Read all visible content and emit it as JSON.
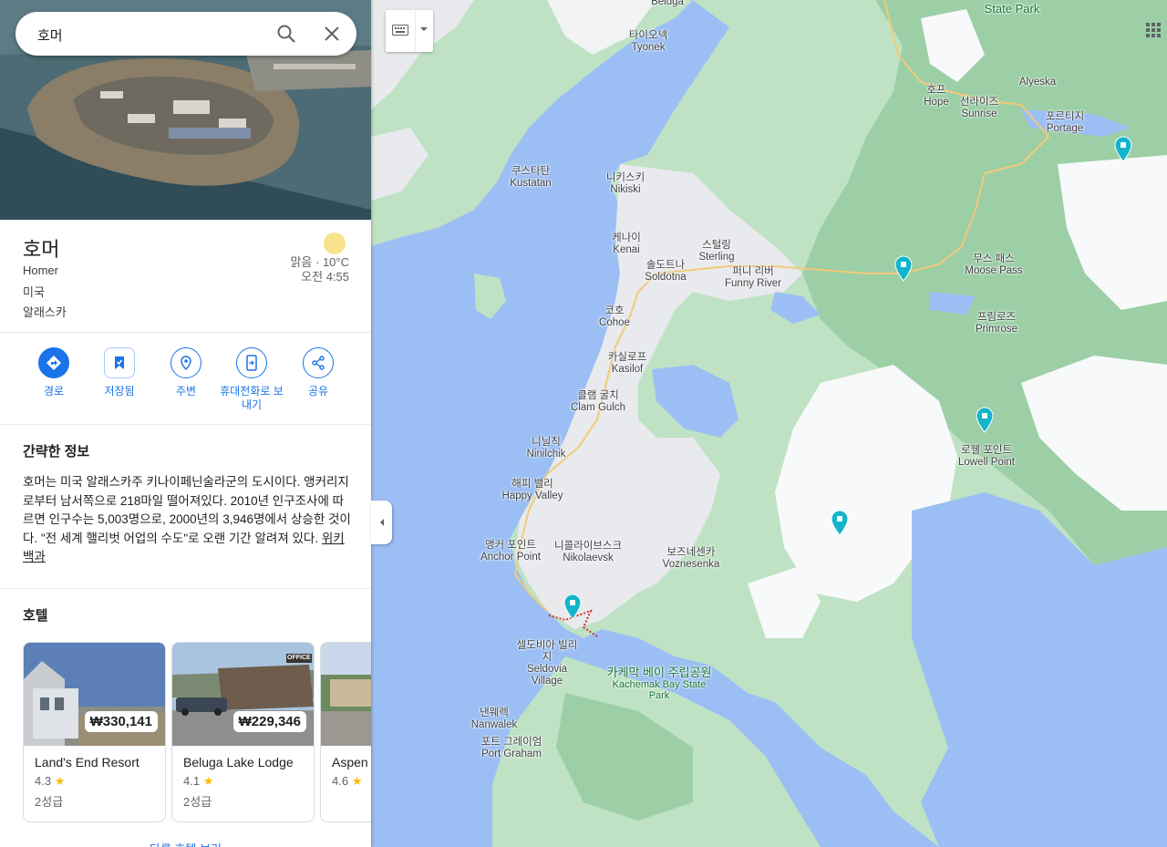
{
  "search": {
    "value": "호머",
    "search_icon": "search-icon",
    "clear_icon": "close-icon"
  },
  "place": {
    "title": "호머",
    "subtitle_en": "Homer",
    "country": "미국",
    "region": "알래스카",
    "weather": {
      "condition": "맑음 · 10°C",
      "time": "오전 4:55",
      "icon": "sun-icon"
    }
  },
  "actions": [
    {
      "label": "경로",
      "icon": "directions-icon"
    },
    {
      "label": "저장됨",
      "icon": "bookmark-icon"
    },
    {
      "label": "주변",
      "icon": "nearby-icon"
    },
    {
      "label": "휴대전화로 보내기",
      "icon": "send-to-phone-icon"
    },
    {
      "label": "공유",
      "icon": "share-icon"
    }
  ],
  "overview": {
    "heading": "간략한 정보",
    "text": "호머는 미국 알래스카주 키나이페닌술라군의 도시이다. 앵커리지로부터 남서쪽으로 218마일 떨어져있다. 2010년 인구조사에 따르면 인구수는 5,003명으로, 2000년의 3,946명에서 상승한 것이다. \"전 세계 핼리벗 어업의 수도\"로 오랜 기간 알려져 있다.",
    "source_link": "위키백과"
  },
  "hotels": {
    "heading": "호텔",
    "items": [
      {
        "name": "Land's End Resort",
        "price": "₩330,141",
        "rating": "4.3",
        "class": "2성급"
      },
      {
        "name": "Beluga Lake Lodge",
        "price": "₩229,346",
        "rating": "4.1",
        "class": "2성급"
      },
      {
        "name": "Aspen",
        "price": "",
        "rating": "4.6",
        "class": ""
      }
    ],
    "more_link": "다른 호텔 보기"
  },
  "map": {
    "labels": [
      {
        "ko": "",
        "en": "Beluga"
      },
      {
        "ko": "타이오넥",
        "en": "Tyonek"
      },
      {
        "ko": "",
        "en": "State Park"
      },
      {
        "ko": "",
        "en": "Alyeska"
      },
      {
        "ko": "호프",
        "en": "Hope"
      },
      {
        "ko": "선라이즈",
        "en": "Sunrise"
      },
      {
        "ko": "포르티지",
        "en": "Portage"
      },
      {
        "ko": "쿠스타탄",
        "en": "Kustatan"
      },
      {
        "ko": "니키스키",
        "en": "Nikiski"
      },
      {
        "ko": "케나이",
        "en": "Kenai"
      },
      {
        "ko": "스털링",
        "en": "Sterling"
      },
      {
        "ko": "솔도트나",
        "en": "Soldotna"
      },
      {
        "ko": "퍼니 리버",
        "en": "Funny River"
      },
      {
        "ko": "무스 패스",
        "en": "Moose Pass"
      },
      {
        "ko": "프림로즈",
        "en": "Primrose"
      },
      {
        "ko": "코호",
        "en": "Cohoe"
      },
      {
        "ko": "카실로프",
        "en": "Kasilof"
      },
      {
        "ko": "클램 굴치",
        "en": "Clam Gulch"
      },
      {
        "ko": "로웰 포인트",
        "en": "Lowell Point"
      },
      {
        "ko": "니닐칙",
        "en": "Ninilchik"
      },
      {
        "ko": "해피 밸리",
        "en": "Happy Valley"
      },
      {
        "ko": "앵커 포인트",
        "en": "Anchor Point"
      },
      {
        "ko": "니콜라이브스크",
        "en": "Nikolaevsk"
      },
      {
        "ko": "보즈네센카",
        "en": "Voznesenka"
      },
      {
        "ko": "셀도비아 빌리지",
        "en": "Seldovia Village"
      },
      {
        "ko": "카케막 베이 주립공원",
        "en": "Kachemak Bay State Park"
      },
      {
        "ko": "낸웨렉",
        "en": "Nanwalek"
      },
      {
        "ko": "포트 그레이엄",
        "en": "Port Graham"
      }
    ],
    "keyboard_icon": "keyboard-icon",
    "apps_icon": "apps-grid-icon",
    "collapse_icon": "chevron-left-icon"
  }
}
